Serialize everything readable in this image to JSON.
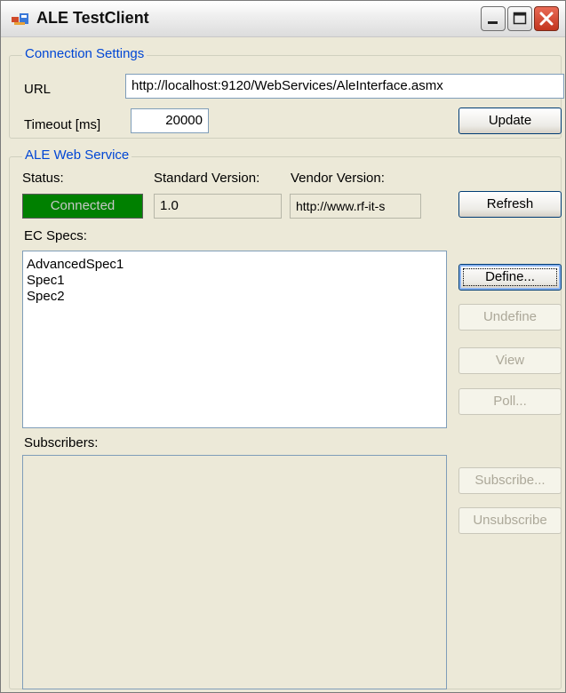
{
  "window": {
    "title": "ALE TestClient"
  },
  "connection": {
    "legend": "Connection Settings",
    "url_label": "URL",
    "url_value": "http://localhost:9120/WebServices/AleInterface.asmx",
    "timeout_label": "Timeout [ms]",
    "timeout_value": "20000",
    "update_label": "Update"
  },
  "service": {
    "legend": "ALE Web Service",
    "status_label": "Status:",
    "status_value": "Connected",
    "standard_version_label": "Standard Version:",
    "standard_version_value": "1.0",
    "vendor_version_label": "Vendor Version:",
    "vendor_version_value": "http://www.rf-it-s",
    "refresh_label": "Refresh",
    "ec_specs_label": "EC Specs:",
    "ec_specs": [
      "AdvancedSpec1",
      "Spec1",
      "Spec2"
    ],
    "define_label": "Define...",
    "undefine_label": "Undefine",
    "view_label": "View",
    "poll_label": "Poll...",
    "subscribers_label": "Subscribers:",
    "subscribe_label": "Subscribe...",
    "unsubscribe_label": "Unsubscribe"
  },
  "colors": {
    "status_connected": "#008000",
    "legend_text": "#0046d5",
    "window_background": "#ece9d8"
  }
}
